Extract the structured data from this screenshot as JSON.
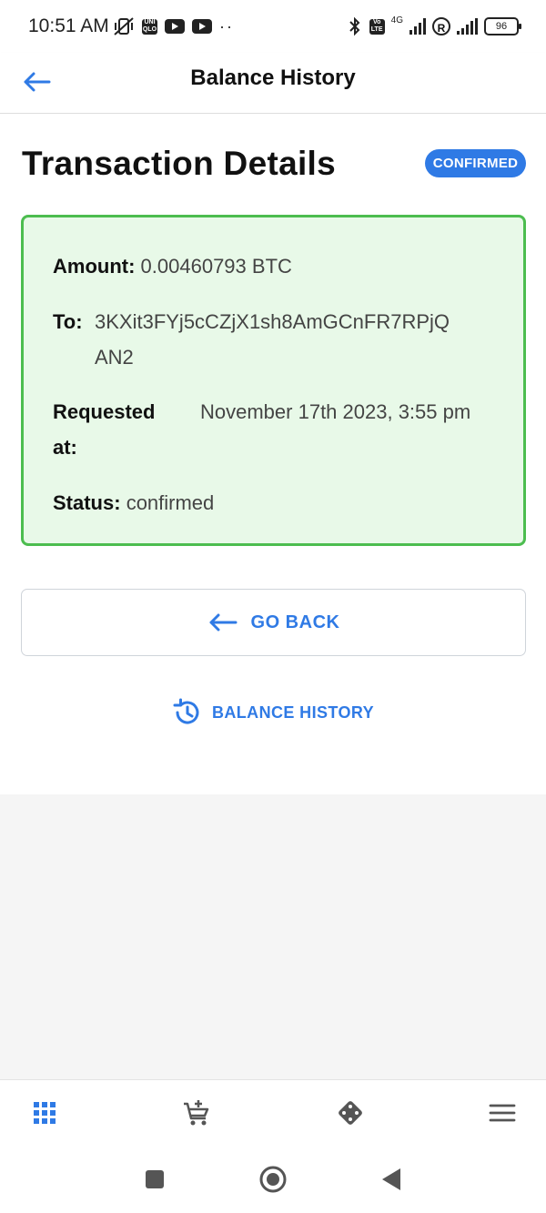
{
  "status_bar": {
    "time": "10:51 AM",
    "uniqlo_badge": "UNI QLO",
    "volte_badge": "Vo LTE",
    "network": "4G",
    "registered_mark": "R",
    "battery": "96"
  },
  "app_bar": {
    "title": "Balance History",
    "back_icon": "arrow-left-icon"
  },
  "page": {
    "title": "Transaction Details",
    "status_badge": "CONFIRMED"
  },
  "details": {
    "amount_label": "Amount:",
    "amount_value": "0.00460793 BTC",
    "to_label": "To:",
    "to_value": "3KXit3FYj5cCZjX1sh8AmGCnFR7RPjQAN2",
    "requested_label": "Requested at:",
    "requested_value": "November 17th 2023, 3:55 pm",
    "status_label": "Status:",
    "status_value": "confirmed"
  },
  "actions": {
    "go_back_label": "GO BACK",
    "balance_history_label": "BALANCE HISTORY"
  },
  "bottom_nav": [
    {
      "icon": "grid-icon",
      "active": true
    },
    {
      "icon": "cart-add-icon",
      "active": false
    },
    {
      "icon": "dice-icon",
      "active": false
    },
    {
      "icon": "menu-icon",
      "active": false
    }
  ],
  "colors": {
    "accent": "#2f7ae5",
    "card_border": "#4cbd4f",
    "card_background": "#e8f9e8"
  }
}
